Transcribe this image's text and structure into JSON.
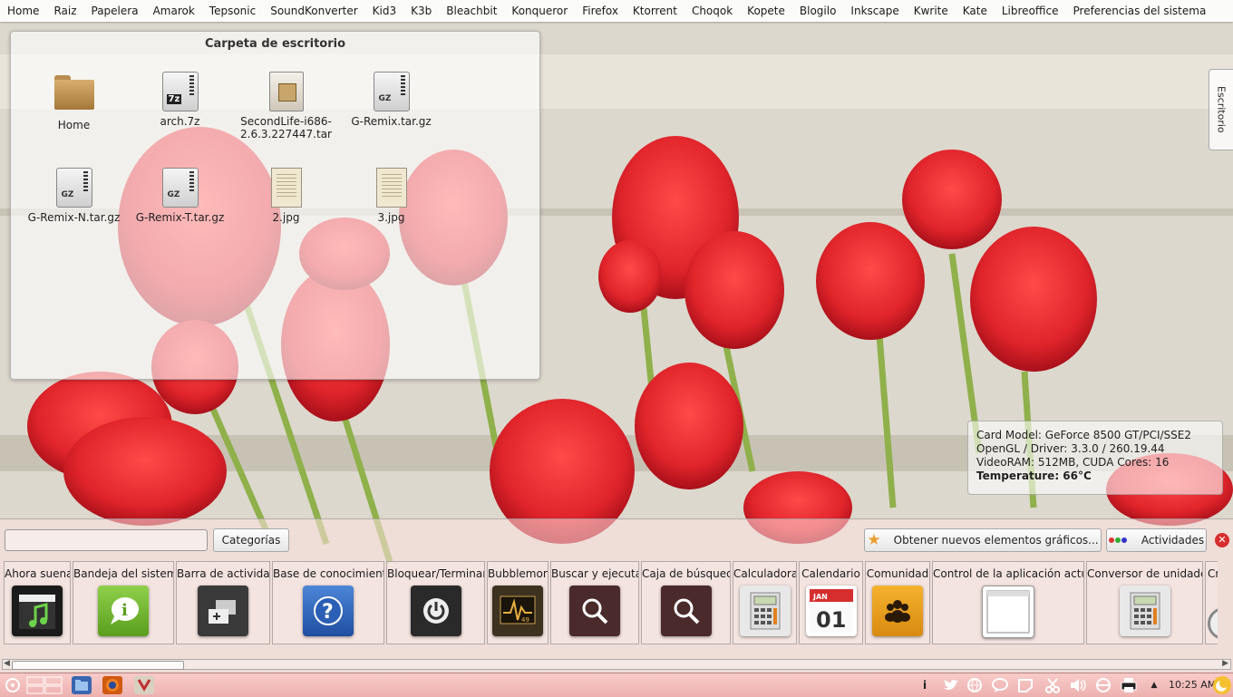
{
  "top_panel": {
    "items": [
      "Home",
      "Raiz",
      "Papelera",
      "Amarok",
      "Tepsonic",
      "SoundKonverter",
      "Kid3",
      "K3b",
      "Bleachbit",
      "Konqueror",
      "Firefox",
      "Ktorrent",
      "Choqok",
      "Kopete",
      "Blogilo",
      "Inkscape",
      "Kwrite",
      "Kate",
      "Libreoffice",
      "Preferencias del sistema"
    ]
  },
  "folder_view": {
    "title": "Carpeta de escritorio",
    "files": [
      {
        "name": "Home",
        "type": "folder"
      },
      {
        "name": "arch.7z",
        "type": "7z"
      },
      {
        "name": "SecondLife-i686-2.6.3.227447.tar",
        "type": "pkg"
      },
      {
        "name": "G-Remix.tar.gz",
        "type": "gz"
      },
      {
        "name": "G-Remix-N.tar.gz",
        "type": "gz"
      },
      {
        "name": "G-Remix-T.tar.gz",
        "type": "gz"
      },
      {
        "name": "2.jpg",
        "type": "jpg"
      },
      {
        "name": "3.jpg",
        "type": "jpg"
      }
    ]
  },
  "side_tab": {
    "label": "Escritorio"
  },
  "gpu_info": {
    "line1": "Card Model: GeForce 8500 GT/PCI/SSE2",
    "line2": "OpenGL / Driver: 3.3.0 / 260.19.44",
    "line3": "VideoRAM: 512MB, CUDA Cores: 16",
    "line4": "Temperature: 66°C"
  },
  "widget_explorer": {
    "search_placeholder": "",
    "categories_label": "Categorías",
    "get_new_label": "Obtener nuevos elementos gráficos...",
    "activities_label": "Actividades",
    "close_symbol": "✕",
    "widgets": [
      {
        "label": "Ahora suena",
        "icon": "clapperboard-music-icon"
      },
      {
        "label": "Bandeja del sistema",
        "icon": "info-bubble-icon"
      },
      {
        "label": "Barra de actividad",
        "icon": "activity-bar-icon"
      },
      {
        "label": "Base de conocimiento",
        "icon": "question-icon"
      },
      {
        "label": "Bloquear/Terminar",
        "icon": "power-icon"
      },
      {
        "label": "Bubblemon",
        "icon": "monitor-graph-icon",
        "badge": "49"
      },
      {
        "label": "Buscar y ejecutar",
        "icon": "magnifier-icon"
      },
      {
        "label": "Caja de búsqueda",
        "icon": "magnifier-icon"
      },
      {
        "label": "Calculadora",
        "icon": "calculator-icon"
      },
      {
        "label": "Calendario",
        "icon": "calendar-icon",
        "month": "JAN",
        "day": "01"
      },
      {
        "label": "Comunidad",
        "icon": "community-icon"
      },
      {
        "label": "Control de la aplicación actual",
        "icon": "app-window-icon"
      },
      {
        "label": "Conversor de unidades",
        "icon": "calculator-icon"
      },
      {
        "label": "Cro",
        "icon": "clock-icon"
      }
    ]
  },
  "taskbar": {
    "clock": "10:25 AM",
    "tray_info": "i"
  },
  "colors": {
    "panel_pink": "#f0b0b0",
    "close_red": "#d62e2e",
    "tulip_red": "#e0242b"
  }
}
